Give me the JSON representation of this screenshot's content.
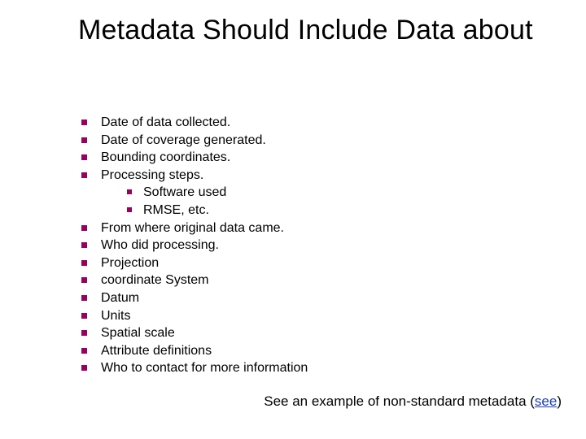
{
  "title": "Metadata Should Include Data about",
  "bullets": [
    {
      "text": "Date of data collected."
    },
    {
      "text": "Date of coverage generated."
    },
    {
      "text": "Bounding coordinates."
    },
    {
      "text": "Processing steps.",
      "children": [
        {
          "text": "Software used"
        },
        {
          "text": "RMSE, etc."
        }
      ]
    },
    {
      "text": "From where original data came."
    },
    {
      "text": "Who did processing."
    },
    {
      "text": "Projection"
    },
    {
      "text": "coordinate System"
    },
    {
      "text": "Datum"
    },
    {
      "text": "Units"
    },
    {
      "text": "Spatial scale"
    },
    {
      "text": "Attribute definitions"
    },
    {
      "text": "Who to contact for more information"
    }
  ],
  "footer": {
    "prefix": "See an example of non-standard metadata (",
    "link_text": "see",
    "suffix": ")"
  },
  "colors": {
    "bullet": "#9a0060",
    "link": "#1a3fb0"
  }
}
